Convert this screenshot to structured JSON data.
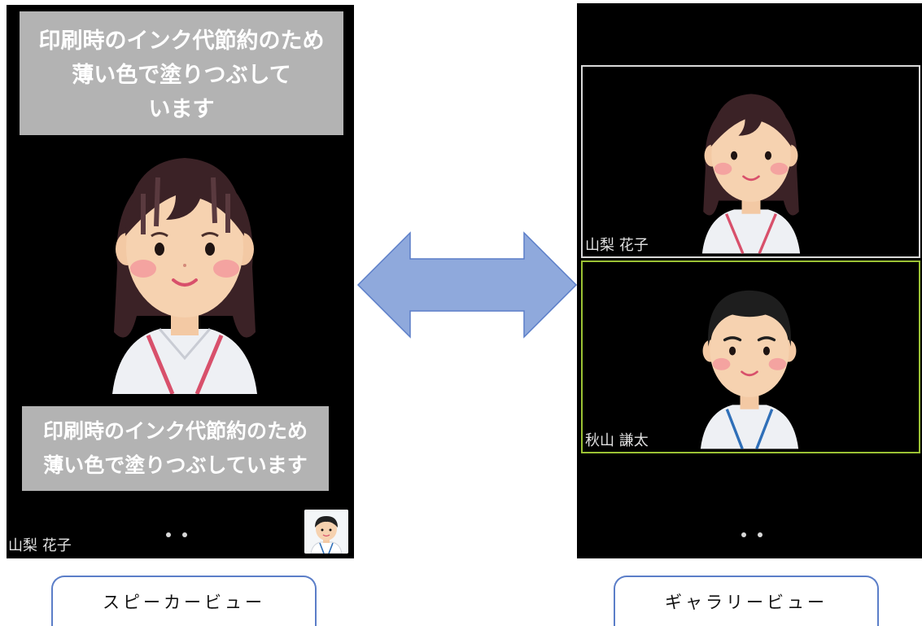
{
  "speaker_view": {
    "overlay_top": [
      "印刷時のインク代節約のため",
      "薄い色で塗りつぶして",
      "います"
    ],
    "overlay_bottom": [
      "印刷時のインク代節約のため",
      "薄い色で塗りつぶしています"
    ],
    "speaker_name": "山梨 花子",
    "page_dot_count": 2,
    "caption": "スピーカービュー"
  },
  "gallery_view": {
    "tiles": [
      {
        "name": "山梨 花子",
        "border_color": "#d9d9d9"
      },
      {
        "name": "秋山 謙太",
        "border_color": "#9bc234"
      }
    ],
    "page_dot_count": 2,
    "caption": "ギャラリービュー"
  },
  "colors": {
    "overlay_gray": "#b3b3b3",
    "arrow_fill": "#8fa9dc",
    "arrow_stroke": "#5b7ec8",
    "caption_border": "#5b7ec8",
    "active_speaker_border": "#9bc234"
  },
  "icons": {
    "female_avatar": "female-avatar-icon",
    "male_avatar": "male-avatar-icon",
    "double_arrow": "double-arrow-icon"
  }
}
